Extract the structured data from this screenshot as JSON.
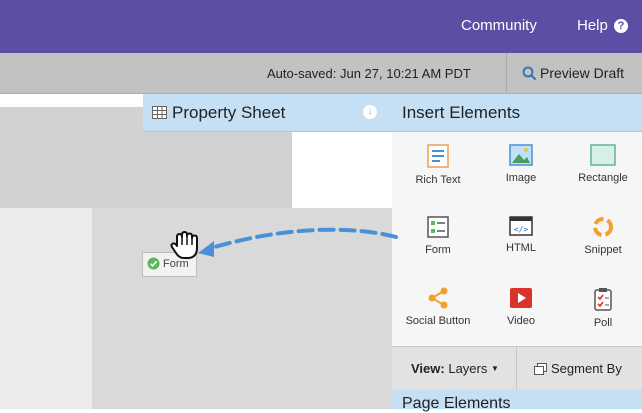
{
  "topbar": {
    "community": "Community",
    "help": "Help"
  },
  "toolbar": {
    "autosave": "Auto-saved: Jun 27, 10:21 AM PDT",
    "preview": "Preview Draft"
  },
  "property_sheet": {
    "title": "Property Sheet"
  },
  "insert_elements": {
    "title": "Insert Elements",
    "items": [
      {
        "label": "Rich Text",
        "icon": "rich-text-icon"
      },
      {
        "label": "Image",
        "icon": "image-icon"
      },
      {
        "label": "Rectangle",
        "icon": "rectangle-icon"
      },
      {
        "label": "Form",
        "icon": "form-icon"
      },
      {
        "label": "HTML",
        "icon": "html-icon"
      },
      {
        "label": "Snippet",
        "icon": "snippet-icon"
      },
      {
        "label": "Social Button",
        "icon": "social-button-icon"
      },
      {
        "label": "Video",
        "icon": "video-icon"
      },
      {
        "label": "Poll",
        "icon": "poll-icon"
      }
    ]
  },
  "view_bar": {
    "view_label": "View:",
    "view_value": "Layers",
    "segment": "Segment By"
  },
  "page_elements": {
    "title": "Page Elements"
  },
  "dragged": {
    "label": "Form"
  }
}
